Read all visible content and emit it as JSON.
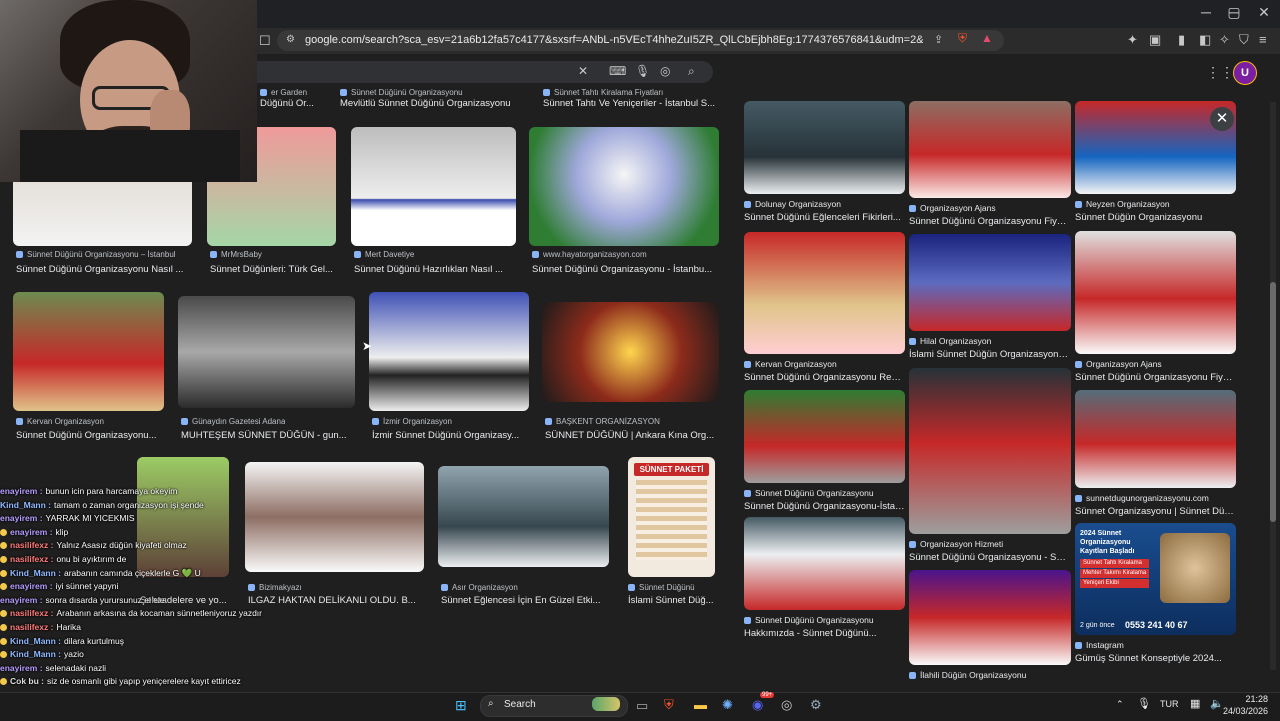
{
  "browser": {
    "url": "google.com/search?sca_esv=21a6b12fa57c4177&sxsrf=ANbL-n5VEcT4hheZuI5ZR_QlLCbEjbh8Eg:1774376576841&udm=2&fbs=ADc_l-av7Nuy-pkYB...",
    "profile_initial": "U"
  },
  "results_left": [
    {
      "source": "er Garden",
      "title": "Düğünü Or..."
    },
    {
      "source": "Sünnet Düğünü Organizasyonu",
      "title": "Mevlütlü Sünnet Düğünü Organizasyonu"
    },
    {
      "source": "Sünnet Tahtı Kiralama Fiyatları",
      "title": "Sünnet Tahtı Ve Yeniçeriler - İstanbul S..."
    },
    {
      "source": "Sünnet Düğünü Organizasyonu – İstanbul",
      "title": "Sünnet Düğünü Organizasyonu Nasıl ..."
    },
    {
      "source": "MrMrsBaby",
      "title": "Sünnet Düğünleri: Türk Gel..."
    },
    {
      "source": "Mert Davetiye",
      "title": "Sünnet Düğünü Hazırlıkları Nasıl ..."
    },
    {
      "source": "www.hayatorganizasyon.com",
      "title": "Sünnet Düğünü Organizasyonu - İstanbu..."
    },
    {
      "source": "Kervan Organizasyon",
      "title": "Sünnet Düğünü Organizasyonu..."
    },
    {
      "source": "Günaydın Gazetesi Adana",
      "title": "MUHTEŞEM SÜNNET DÜĞÜN - gun..."
    },
    {
      "source": "İzmir Organizasyon",
      "title": "İzmir Sünnet Düğünü Organizasy..."
    },
    {
      "source": "BAŞKENT ORGANİZASYON",
      "title": "SÜNNET DÜĞÜNÜ | Ankara Kına Org..."
    },
    {
      "source": "",
      "title": "Şehzadelere ve yo..."
    },
    {
      "source": "Bizimakyazı",
      "title": "ILGAZ HAKTAN DELİKANLI OLDU. B..."
    },
    {
      "source": "Asır Organizasyon",
      "title": "Sünnet Eğlencesi İçin En Güzel Etki..."
    },
    {
      "source": "Sünnet Düğünü",
      "title": "İslami Sünnet Düğ..."
    }
  ],
  "results_right": [
    {
      "source": "Dolunay Organizasyon",
      "title": "Sünnet Düğünü Eğlenceleri Fikirleri..."
    },
    {
      "source": "Organizasyon Ajans",
      "title": "Sünnet Düğünü Organizasyonu Fiyatları..."
    },
    {
      "source": "Neyzen Organizasyon",
      "title": "Sünnet Düğün Organizasyonu"
    },
    {
      "source": "Kervan Organizasyon",
      "title": "Sünnet Düğünü Organizasyonu Resimle..."
    },
    {
      "source": "Hilal Organizasyon",
      "title": "İslami Sünnet Düğün Organizasyonu -..."
    },
    {
      "source": "Organizasyon Ajans",
      "title": "Sünnet Düğünü Organizasyonu Fiyatları..."
    },
    {
      "source": "Sünnet Düğünü Organizasyonu",
      "title": "Sünnet Düğünü Organizasyonu-İstanbu..."
    },
    {
      "source": "sunnetdugunorganizasyonu.com",
      "title": "Sünnet Organizasyonu | Sünnet Düğünü..."
    },
    {
      "source": "Organizasyon Hizmeti",
      "title": "Sünnet Düğünü Organizasyonu - Sünne..."
    },
    {
      "source": "Sünnet Düğünü Organizasyonu",
      "title": "Hakkımızda - Sünnet Düğünü..."
    },
    {
      "source": "Instagram",
      "title": "Gümüş Sünnet Konseptiyle 2024..."
    },
    {
      "source": "İlahili Düğün Organizasyonu",
      "title": ""
    }
  ],
  "ad": {
    "badge": "2 gün önce",
    "phone": "0553 241 40 67",
    "header": "2024 Sünnet Organizasyonu Kayıtları Başladı",
    "lines": [
      "Sünnet Tahtı Kiralama",
      "Mehter Takımı Kiralama",
      "Yeniçeri Ekibi"
    ]
  },
  "paket_tile": "SÜNNET PAKETİ",
  "chat": [
    {
      "user": "enayirem",
      "msg": "bunun icin para harcamaya okeyim",
      "color": "#b59cff",
      "badge": false
    },
    {
      "user": "Kind_Mann",
      "msg": "tamam o zaman organizasyon işi şende",
      "color": "#8fb8ff",
      "badge": false
    },
    {
      "user": "enayirem",
      "msg": "YARRAK MI YICEKMIS",
      "color": "#b59cff",
      "badge": false
    },
    {
      "user": "enayirem",
      "msg": "klip",
      "color": "#b59cff",
      "badge": true
    },
    {
      "user": "nasilifexz",
      "msg": "Yalnız Asasız düğün kiyafeti olmaz",
      "color": "#ff7a7a",
      "badge": true
    },
    {
      "user": "nasilifexz",
      "msg": "onu bi ayıktırım de",
      "color": "#ff7a7a",
      "badge": true
    },
    {
      "user": "Kind_Mann",
      "msg": "arabanın camında çiçeklerle G 💚 U",
      "color": "#8fb8ff",
      "badge": true
    },
    {
      "user": "enayirem",
      "msg": "iyi sünnet yapyni",
      "color": "#b59cff",
      "badge": true
    },
    {
      "user": "enayirem",
      "msg": "sonra dısarda yurursunuz el ele",
      "color": "#b59cff",
      "badge": false
    },
    {
      "user": "nasilifexz",
      "msg": "Arabanın arkasına da kocaman sünnetleniyoruz yazdır",
      "color": "#ff7a7a",
      "badge": true
    },
    {
      "user": "nasilifexz",
      "msg": "Harika",
      "color": "#ff7a7a",
      "badge": true
    },
    {
      "user": "Kind_Mann",
      "msg": "dilara kurtulmuş",
      "color": "#8fb8ff",
      "badge": true
    },
    {
      "user": "Kind_Mann",
      "msg": "yazio",
      "color": "#8fb8ff",
      "badge": true
    },
    {
      "user": "enayirem",
      "msg": "selenadaki nazli",
      "color": "#b59cff",
      "badge": false
    },
    {
      "user": "Cok bu",
      "msg": "siz de osmanlı gibi yapıp yeniçerelere kayıt ettiricez",
      "color": "#dddddd",
      "badge": true
    }
  ],
  "taskbar": {
    "search": "Search",
    "lang": "TUR",
    "time": "21:28",
    "date": "24/03/2026",
    "notif_count": "99+"
  }
}
